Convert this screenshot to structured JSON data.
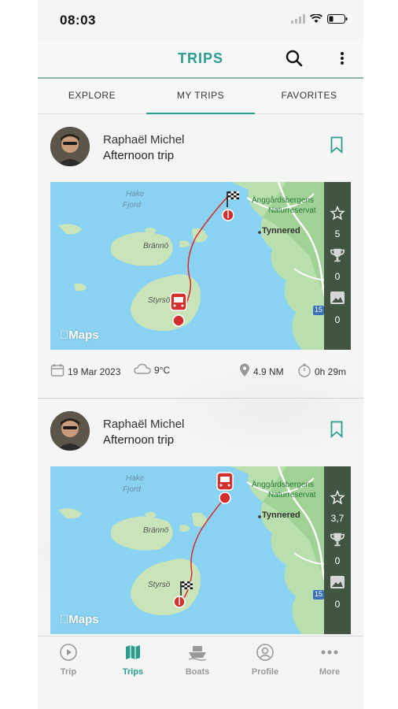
{
  "status_bar": {
    "time": "08:03"
  },
  "header": {
    "title": "TRIPS"
  },
  "tabs": [
    {
      "label": "EXPLORE",
      "active": false
    },
    {
      "label": "MY TRIPS",
      "active": true
    },
    {
      "label": "FAVORITES",
      "active": false
    }
  ],
  "trips": [
    {
      "user": "Raphaël Michel",
      "title": "Afternoon trip",
      "map": {
        "labels": {
          "hake": "Hake",
          "fjord": "Fjord",
          "branno": "Brännö",
          "styrso": "Styrsö",
          "tynnered": "Tynnered",
          "reserve1": "Änggårdsbergens",
          "reserve2": "Naturreservat",
          "road": "15",
          "maps": "Maps"
        }
      },
      "stats": {
        "stars": "5",
        "trophies": "0",
        "photos": "0"
      },
      "date": "19 Mar 2023",
      "weather": "9°C",
      "distance": "4.9 NM",
      "duration": "0h 29m"
    },
    {
      "user": "Raphaël Michel",
      "title": "Afternoon trip",
      "map": {
        "labels": {
          "hake": "Hake",
          "fjord": "Fjord",
          "branno": "Brännö",
          "styrso": "Styrsö",
          "tynnered": "Tynnered",
          "reserve1": "Änggårdsbergens",
          "reserve2": "Naturreservat",
          "road": "15",
          "maps": "Maps"
        }
      },
      "stats": {
        "stars": "3,7",
        "trophies": "0",
        "photos": "0"
      }
    }
  ],
  "bottom_nav": [
    {
      "label": "Trip",
      "icon": "play-circle-icon",
      "active": false
    },
    {
      "label": "Trips",
      "icon": "map-icon",
      "active": true
    },
    {
      "label": "Boats",
      "icon": "boat-icon",
      "active": false
    },
    {
      "label": "Profile",
      "icon": "profile-icon",
      "active": false
    },
    {
      "label": "More",
      "icon": "more-dots-icon",
      "active": false
    }
  ],
  "colors": {
    "accent": "#2a9d8f",
    "panel": "#425542",
    "route": "#d32f2f",
    "water": "#8ad2f2"
  }
}
